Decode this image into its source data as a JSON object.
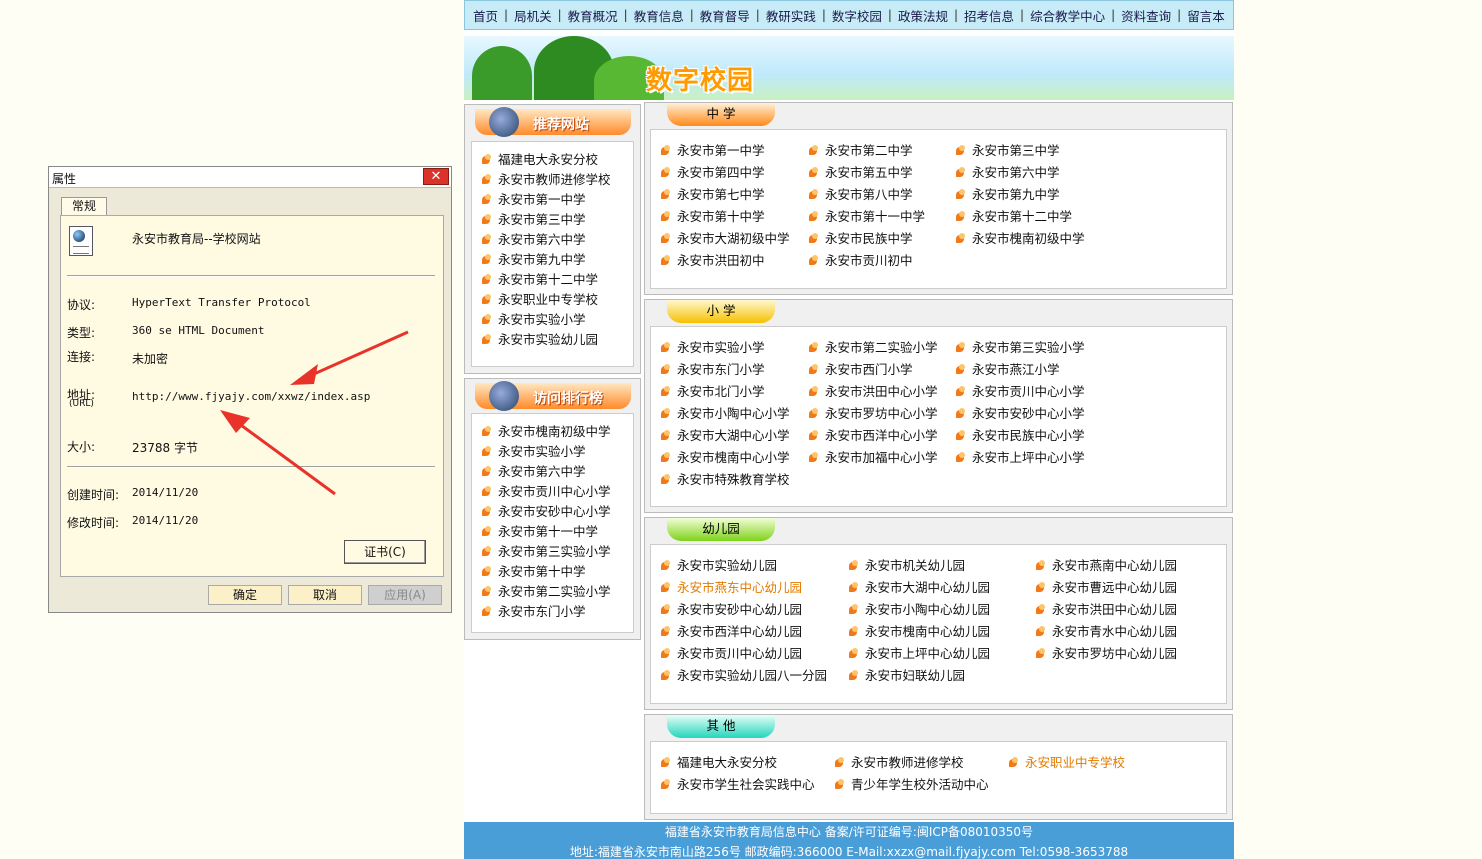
{
  "nav": [
    "首页",
    "局机关",
    "教育概况",
    "教育信息",
    "教育督导",
    "教研实践",
    "数字校园",
    "政策法规",
    "招考信息",
    "综合教学中心",
    "资料查询",
    "留言本"
  ],
  "banner": {
    "title": "数字校园"
  },
  "recommend": {
    "title": "推荐网站",
    "items": [
      "福建电大永安分校",
      "永安市教师进修学校",
      "永安市第一中学",
      "永安市第三中学",
      "永安市第六中学",
      "永安市第九中学",
      "永安市第十二中学",
      "永安职业中专学校",
      "永安市实验小学",
      "永安市实验幼儿园"
    ]
  },
  "ranking": {
    "title": "访问排行榜",
    "items": [
      "永安市槐南初级中学",
      "永安市实验小学",
      "永安市第六中学",
      "永安市贡川中心小学",
      "永安市安砂中心小学",
      "永安市第十一中学",
      "永安市第三实验小学",
      "永安市第十中学",
      "永安市第二实验小学",
      "永安市东门小学"
    ]
  },
  "middle": {
    "title": "中 学",
    "items": [
      "永安市第一中学",
      "永安市第二中学",
      "永安市第三中学",
      "永安市第四中学",
      "永安市第五中学",
      "永安市第六中学",
      "永安市第七中学",
      "永安市第八中学",
      "永安市第九中学",
      "永安市第十中学",
      "永安市第十一中学",
      "永安市第十二中学",
      "永安市大湖初级中学",
      "永安市民族中学",
      "永安市槐南初级中学",
      "永安市洪田初中",
      "永安市贡川初中"
    ]
  },
  "primary": {
    "title": "小 学",
    "items": [
      "永安市实验小学",
      "永安市第二实验小学",
      "永安市第三实验小学",
      "永安市东门小学",
      "永安市西门小学",
      "永安市燕江小学",
      "永安市北门小学",
      "永安市洪田中心小学",
      "永安市贡川中心小学",
      "永安市小陶中心小学",
      "永安市罗坊中心小学",
      "永安市安砂中心小学",
      "永安市大湖中心小学",
      "永安市西洋中心小学",
      "永安市民族中心小学",
      "永安市槐南中心小学",
      "永安市加福中心小学",
      "永安市上坪中心小学",
      "永安市特殊教育学校"
    ]
  },
  "kindergarten": {
    "title": "幼儿园",
    "items": [
      "永安市实验幼儿园",
      "永安市机关幼儿园",
      "永安市燕南中心幼儿园",
      "永安市燕东中心幼儿园",
      "永安市大湖中心幼儿园",
      "永安市曹远中心幼儿园",
      "永安市安砂中心幼儿园",
      "永安市小陶中心幼儿园",
      "永安市洪田中心幼儿园",
      "永安市西洋中心幼儿园",
      "永安市槐南中心幼儿园",
      "永安市青水中心幼儿园",
      "永安市贡川中心幼儿园",
      "永安市上坪中心幼儿园",
      "永安市罗坊中心幼儿园",
      "永安市实验幼儿园八一分园",
      "永安市妇联幼儿园"
    ]
  },
  "other": {
    "title": "其 他",
    "items": [
      "福建电大永安分校",
      "永安市教师进修学校",
      "永安职业中专学校",
      "永安市学生社会实践中心",
      "青少年学生校外活动中心"
    ]
  },
  "footer": {
    "line1": "福建省永安市教育局信息中心 备案/许可证编号:闽ICP备08010350号",
    "line2": "地址:福建省永安市南山路256号 邮政编码:366000 E-Mail:xxzx@mail.fjyajy.com Tel:0598-3653788"
  },
  "dialog": {
    "title": "属性",
    "close": "✕",
    "tab": "常规",
    "file_name": "永安市教育局--学校网站",
    "protocol_label": "协议:",
    "protocol": "HyperText Transfer Protocol",
    "type_label": "类型:",
    "type": "360 se HTML Document",
    "conn_label": "连接:",
    "conn": "未加密",
    "addr_label": "地址:",
    "addr_sub": "(URL)",
    "addr": "http://www.fjyajy.com/xxwz/index.asp",
    "size_label": "大小:",
    "size": "23788 字节",
    "created_label": "创建时间:",
    "created": "2014/11/20",
    "modified_label": "修改时间:",
    "modified": "2014/11/20",
    "cert": "证书(C)",
    "ok": "确定",
    "cancel": "取消",
    "apply": "应用(A)"
  },
  "colors": {
    "nav_bg": "#c7ecf7",
    "footer_bg": "#4a9ed8",
    "highlight": "#e37a00",
    "arrow": "#e8322a"
  }
}
